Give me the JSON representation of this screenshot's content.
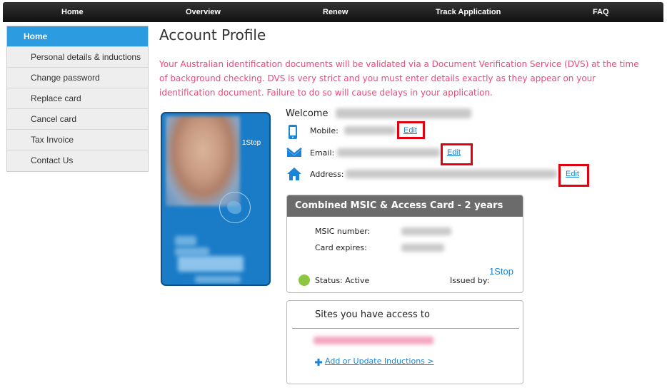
{
  "topnav": {
    "items": [
      {
        "label": "Home"
      },
      {
        "label": "Overview"
      },
      {
        "label": "Renew"
      },
      {
        "label": "Track Application"
      },
      {
        "label": "FAQ"
      }
    ]
  },
  "sidebar": {
    "items": [
      {
        "label": "Home",
        "active": true
      },
      {
        "label": "Personal details & inductions"
      },
      {
        "label": "Change password"
      },
      {
        "label": "Replace card"
      },
      {
        "label": "Cancel card"
      },
      {
        "label": "Tax Invoice"
      },
      {
        "label": "Contact Us"
      }
    ]
  },
  "main": {
    "title": "Account Profile",
    "warning": "Your Australian identification documents will be validated via a Document Verification Service (DVS) at the time of background checking. DVS is very strict and you must enter details exactly as they appear on your identification document. Failure to do so will cause delays in your application."
  },
  "card": {
    "logo_text": "1Stop"
  },
  "profile": {
    "welcome": "Welcome",
    "mobile_label": "Mobile:",
    "email_label": "Email:",
    "address_label": "Address:",
    "edit_label": "Edit"
  },
  "card_panel": {
    "header": "Combined MSIC & Access Card - 2 years",
    "msic_label": "MSIC number:",
    "expires_label": "Card expires:",
    "status_text": "Status: Active",
    "issued_by_label": "Issued by:",
    "issuer_logo": "1Stop"
  },
  "sites": {
    "title": "Sites you have access to",
    "add_link": "Add or Update Inductions >"
  },
  "colors": {
    "accent": "#2d9be0",
    "warning": "#f0487a",
    "highlight": "#e3000f",
    "card_blue": "#1a7cc7",
    "status_active": "#8dc63f"
  }
}
